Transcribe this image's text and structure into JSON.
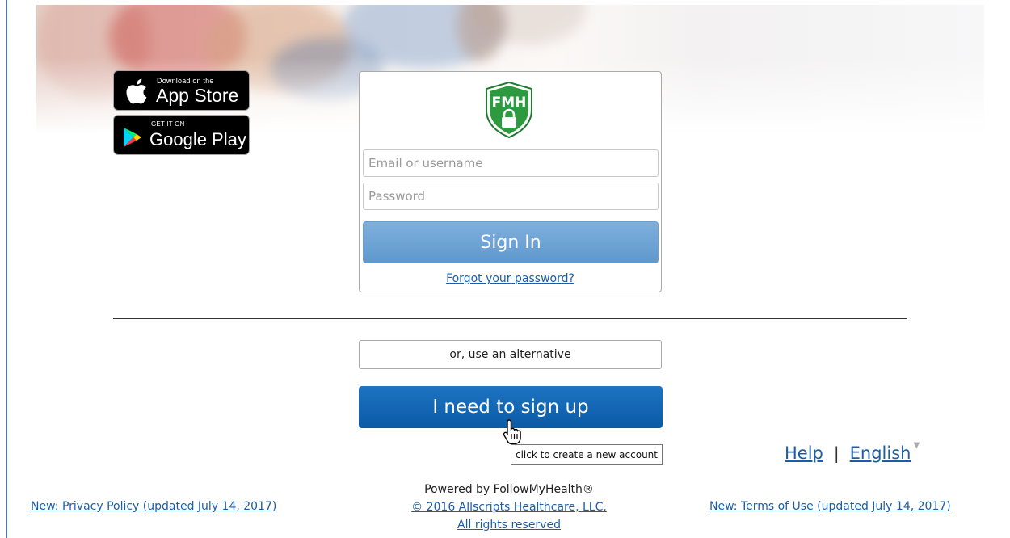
{
  "store_badges": {
    "app_store": {
      "small": "Download on the",
      "big": "App Store"
    },
    "google_play": {
      "small": "GET IT ON",
      "big": "Google Play"
    }
  },
  "login": {
    "logo_text": "FMH",
    "email_placeholder": "Email or username",
    "password_placeholder": "Password",
    "signin_label": "Sign In",
    "forgot_label": "Forgot your password?"
  },
  "alternative_label": "or, use an alternative",
  "signup_label": "I need to sign up",
  "tooltip": "click to create a new account",
  "help_label": "Help",
  "separator": "|",
  "language_label": "English",
  "footer": {
    "powered_by": "Powered by FollowMyHealth®",
    "copyright": "© 2016 Allscripts Healthcare, LLC.",
    "rights": "All rights reserved",
    "privacy": "New: Privacy Policy (updated July 14, 2017)",
    "terms": "New: Terms of Use (updated July 14, 2017)"
  },
  "colors": {
    "link": "#1b5ea8",
    "signin_button": "#6fa5d6",
    "signup_button": "#0f62ad",
    "logo_green": "#2e9a3f"
  }
}
